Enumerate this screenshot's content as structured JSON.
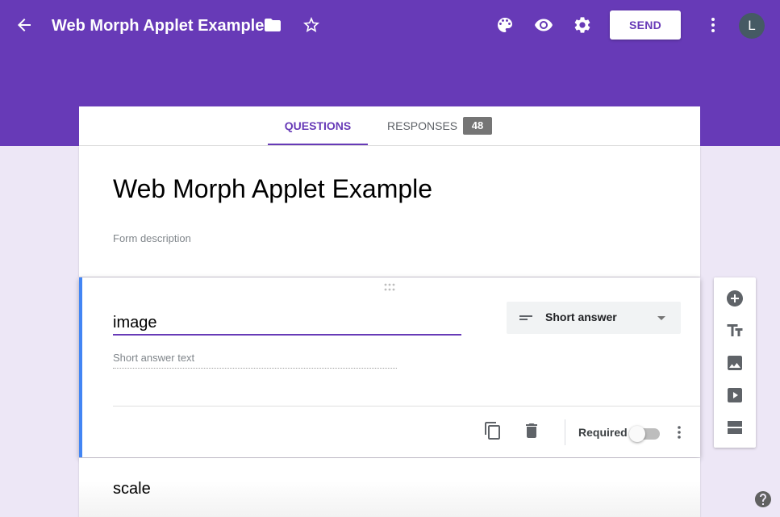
{
  "app": {
    "title": "Web Morph Applet Example",
    "send_label": "SEND",
    "avatar_initial": "L",
    "colors": {
      "theme": "#673ab7",
      "background": "#ede7f6",
      "active_question": "#4285f4"
    },
    "icons": [
      "arrow-back-icon",
      "folder-icon",
      "star-outline-icon",
      "palette-icon",
      "eye-icon",
      "gear-icon",
      "more-vert-icon"
    ]
  },
  "tabs": {
    "questions": "QUESTIONS",
    "responses": "RESPONSES",
    "responses_count": "48"
  },
  "form": {
    "title": "Web Morph Applet Example",
    "description_placeholder": "Form description"
  },
  "question": {
    "title": "image",
    "type": "Short answer",
    "answer_placeholder": "Short answer text",
    "required_label": "Required",
    "required": false,
    "icons": [
      "drag-handle-icon",
      "short-answer-lines-icon",
      "dropdown-caret-icon",
      "copy-icon",
      "trash-icon",
      "more-vert-icon"
    ]
  },
  "next_question": {
    "title": "scale"
  },
  "side_toolbar": {
    "icons": [
      "add-question-icon",
      "add-title-icon",
      "add-image-icon",
      "add-video-icon",
      "add-section-icon"
    ]
  },
  "help": {
    "icon": "help-icon"
  }
}
